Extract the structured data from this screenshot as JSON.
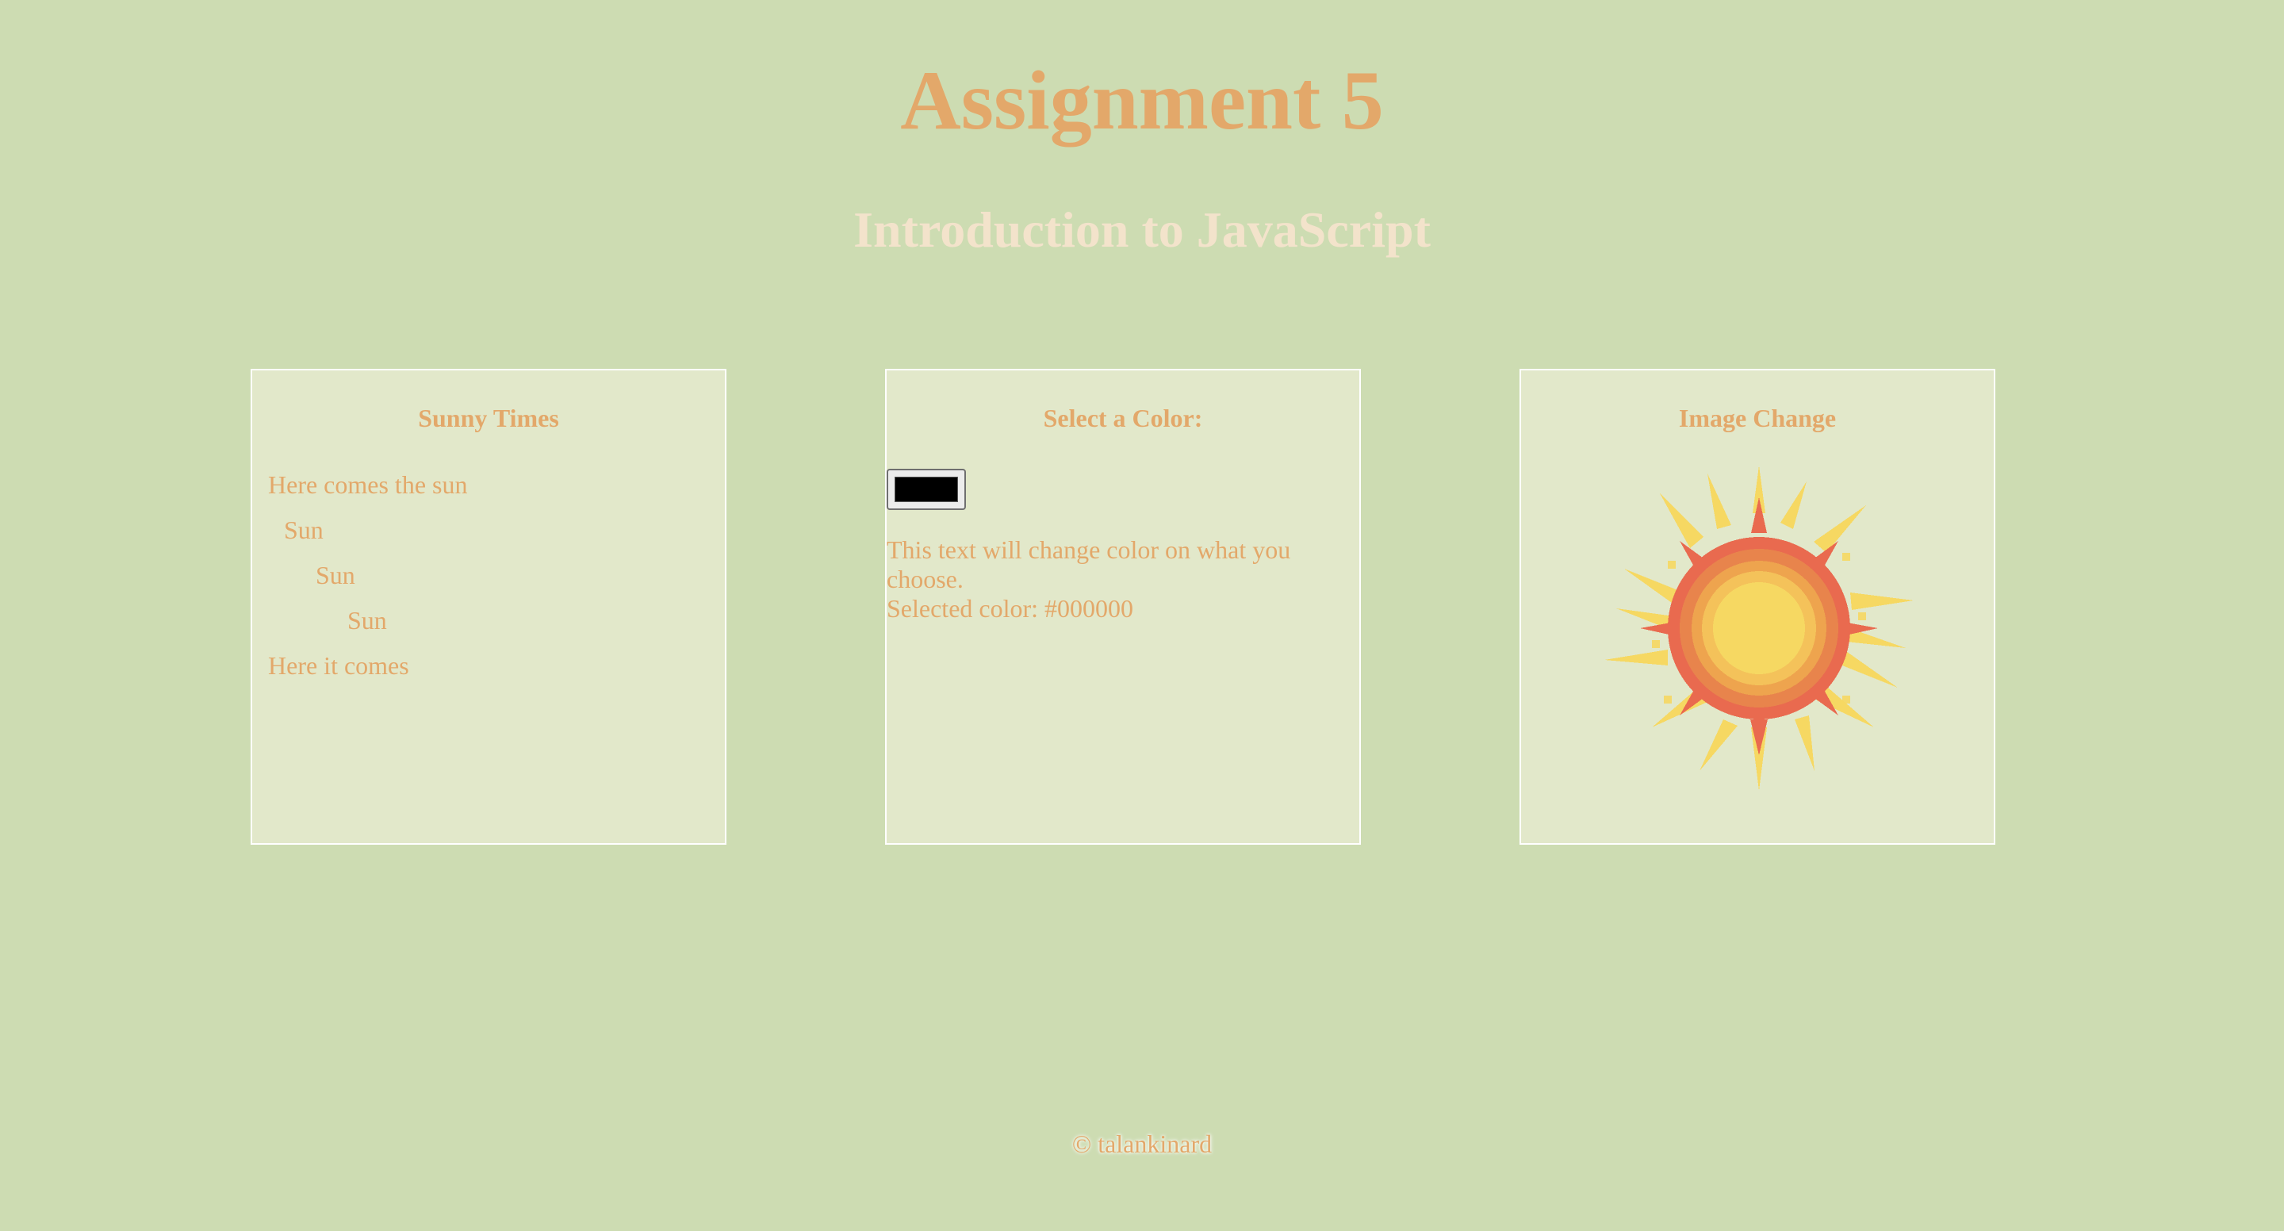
{
  "header": {
    "title": "Assignment 5",
    "subtitle": "Introduction to JavaScript"
  },
  "panels": {
    "sunny": {
      "title": "Sunny Times",
      "lines": [
        "Here comes the sun",
        "Sun",
        "Sun",
        "Sun",
        "Here it comes"
      ]
    },
    "color": {
      "title": "Select a Color:",
      "picker_value": "#000000",
      "description": "This text will change color on what you choose.",
      "selected_label": "Selected color: #000000"
    },
    "image": {
      "title": "Image Change",
      "image_icon": "sun-icon"
    }
  },
  "footer": {
    "copyright": "© talankinard"
  },
  "colors": {
    "background": "#cddcb2",
    "panel": "#e2e8ca",
    "accent": "#e3a86a",
    "subtitle": "#f3e3cb"
  }
}
